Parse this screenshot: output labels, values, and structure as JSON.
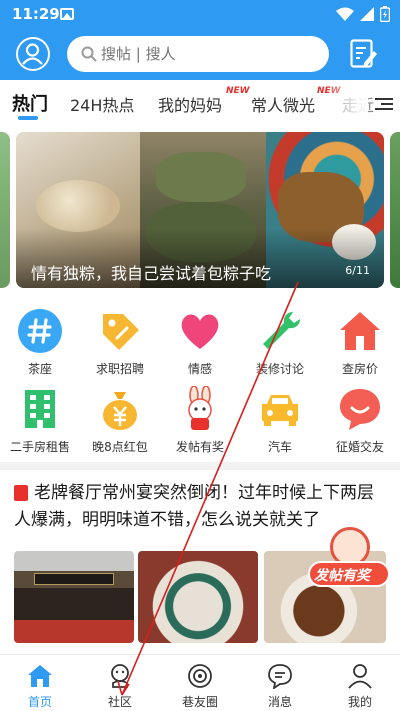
{
  "status_bar": {
    "time": "11:29",
    "icons": [
      "photo-icon",
      "wifi-icon",
      "signal-icon",
      "battery-charging-icon"
    ]
  },
  "header": {
    "search_placeholder": "搜帖 | 搜人",
    "colors": {
      "primary": "#2f9af2"
    }
  },
  "tabs": [
    {
      "label": "热门",
      "active": true
    },
    {
      "label": "24H热点"
    },
    {
      "label": "我的妈妈",
      "badge": "NEW"
    },
    {
      "label": "常人微光",
      "badge": "NEW"
    },
    {
      "label": "走近"
    }
  ],
  "banner": {
    "caption": "情有独粽，我自己尝试着包粽子吃",
    "counter": "6/11"
  },
  "grid": [
    {
      "label": "茶座",
      "icon": "hash-icon"
    },
    {
      "label": "求职招聘",
      "icon": "tag-icon"
    },
    {
      "label": "情感",
      "icon": "heart-icon"
    },
    {
      "label": "装修讨论",
      "icon": "wrench-icon"
    },
    {
      "label": "查房价",
      "icon": "house-icon"
    },
    {
      "label": "二手房租售",
      "icon": "building-icon"
    },
    {
      "label": "晚8点红包",
      "icon": "money-bag-icon"
    },
    {
      "label": "发帖有奖",
      "icon": "rabbit-mascot-icon"
    },
    {
      "label": "汽车",
      "icon": "car-icon"
    },
    {
      "label": "征婚交友",
      "icon": "chat-bubble-icon"
    }
  ],
  "article": {
    "title": "老牌餐厅常州宴突然倒闭！过年时候上下两层人爆满，明明味道不错，怎么说关就关了"
  },
  "promo": {
    "label": "发帖有奖"
  },
  "bottom_nav": [
    {
      "label": "首页",
      "icon": "home-icon",
      "active": true
    },
    {
      "label": "社区",
      "icon": "community-icon"
    },
    {
      "label": "巷友圈",
      "icon": "circle-icon"
    },
    {
      "label": "消息",
      "icon": "message-icon"
    },
    {
      "label": "我的",
      "icon": "person-icon"
    }
  ]
}
